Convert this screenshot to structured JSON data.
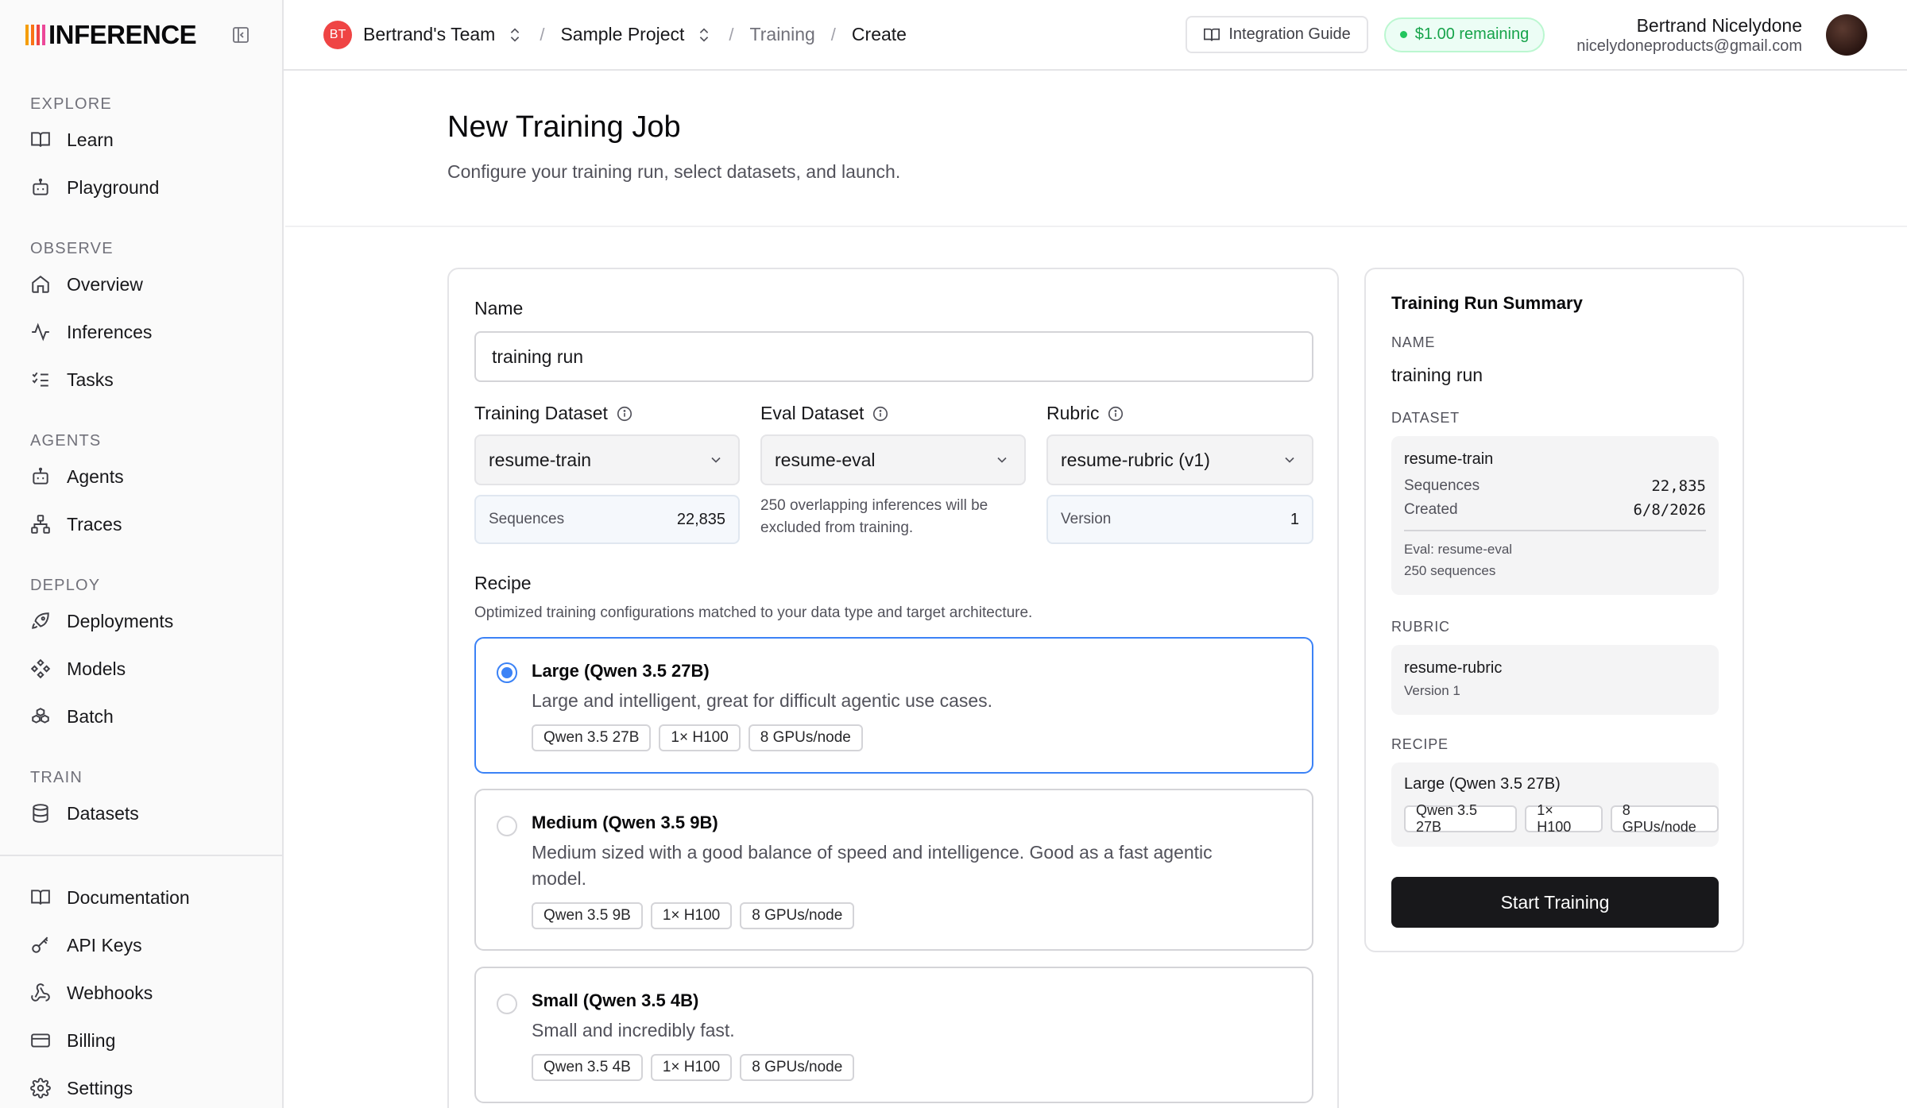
{
  "brand": {
    "name": "INFERENCE",
    "bar_colors": [
      "#f59e0b",
      "#f97316",
      "#ef4444",
      "#ec4899"
    ]
  },
  "sidebar": {
    "sections": [
      {
        "label": "EXPLORE",
        "items": [
          {
            "label": "Learn",
            "icon": "book-icon"
          },
          {
            "label": "Playground",
            "icon": "bot-icon"
          }
        ]
      },
      {
        "label": "OBSERVE",
        "items": [
          {
            "label": "Overview",
            "icon": "home-icon"
          },
          {
            "label": "Inferences",
            "icon": "activity-icon"
          },
          {
            "label": "Tasks",
            "icon": "list-checks-icon"
          }
        ]
      },
      {
        "label": "AGENTS",
        "items": [
          {
            "label": "Agents",
            "icon": "bot-icon"
          },
          {
            "label": "Traces",
            "icon": "network-icon"
          }
        ]
      },
      {
        "label": "DEPLOY",
        "items": [
          {
            "label": "Deployments",
            "icon": "rocket-icon"
          },
          {
            "label": "Models",
            "icon": "models-icon"
          },
          {
            "label": "Batch",
            "icon": "boxes-icon"
          }
        ]
      },
      {
        "label": "TRAIN",
        "items": [
          {
            "label": "Datasets",
            "icon": "database-icon"
          }
        ]
      }
    ],
    "bottom": [
      {
        "label": "Documentation",
        "icon": "book-icon"
      },
      {
        "label": "API Keys",
        "icon": "key-icon"
      },
      {
        "label": "Webhooks",
        "icon": "webhook-icon"
      },
      {
        "label": "Billing",
        "icon": "credit-card-icon"
      },
      {
        "label": "Settings",
        "icon": "gear-icon"
      }
    ]
  },
  "header": {
    "team_initials": "BT",
    "team": "Bertrand's Team",
    "project": "Sample Project",
    "crumb_training": "Training",
    "crumb_create": "Create",
    "guide": "Integration Guide",
    "credits": "$1.00 remaining",
    "user_name": "Bertrand Nicelydone",
    "user_email": "nicelydoneproducts@gmail.com"
  },
  "page": {
    "title": "New Training Job",
    "subtitle": "Configure your training run, select datasets, and launch."
  },
  "form": {
    "name_label": "Name",
    "name_value": "training run",
    "train_label": "Training Dataset",
    "train_value": "resume-train",
    "train_seq_label": "Sequences",
    "train_seq_value": "22,835",
    "eval_label": "Eval Dataset",
    "eval_value": "resume-eval",
    "eval_note": "250 overlapping inferences will be excluded from training.",
    "rubric_label": "Rubric",
    "rubric_value": "resume-rubric (v1)",
    "rubric_ver_label": "Version",
    "rubric_ver_value": "1",
    "recipe_label": "Recipe",
    "recipe_sub": "Optimized training configurations matched to your data type and target architecture.",
    "recipes": [
      {
        "title": "Large (Qwen 3.5 27B)",
        "desc": "Large and intelligent, great for difficult agentic use cases.",
        "tags": [
          "Qwen 3.5 27B",
          "1× H100",
          "8 GPUs/node"
        ]
      },
      {
        "title": "Medium (Qwen 3.5 9B)",
        "desc": "Medium sized with a good balance of speed and intelligence. Good as a fast agentic model.",
        "tags": [
          "Qwen 3.5 9B",
          "1× H100",
          "8 GPUs/node"
        ]
      },
      {
        "title": "Small (Qwen 3.5 4B)",
        "desc": "Small and incredibly fast.",
        "tags": [
          "Qwen 3.5 4B",
          "1× H100",
          "8 GPUs/node"
        ]
      }
    ]
  },
  "summary": {
    "title": "Training Run Summary",
    "name_label": "NAME",
    "name_value": "training run",
    "dataset_label": "DATASET",
    "dataset_name": "resume-train",
    "seq_label": "Sequences",
    "seq_value": "22,835",
    "created_label": "Created",
    "created_value": "6/8/2026",
    "eval_line": "Eval: resume-eval",
    "eval_count": "250 sequences",
    "rubric_label": "RUBRIC",
    "rubric_name": "resume-rubric",
    "rubric_version": "Version 1",
    "recipe_label": "RECIPE",
    "recipe_name": "Large (Qwen 3.5 27B)",
    "recipe_tags": [
      "Qwen 3.5 27B",
      "1× H100",
      "8 GPUs/node"
    ],
    "start": "Start Training"
  }
}
